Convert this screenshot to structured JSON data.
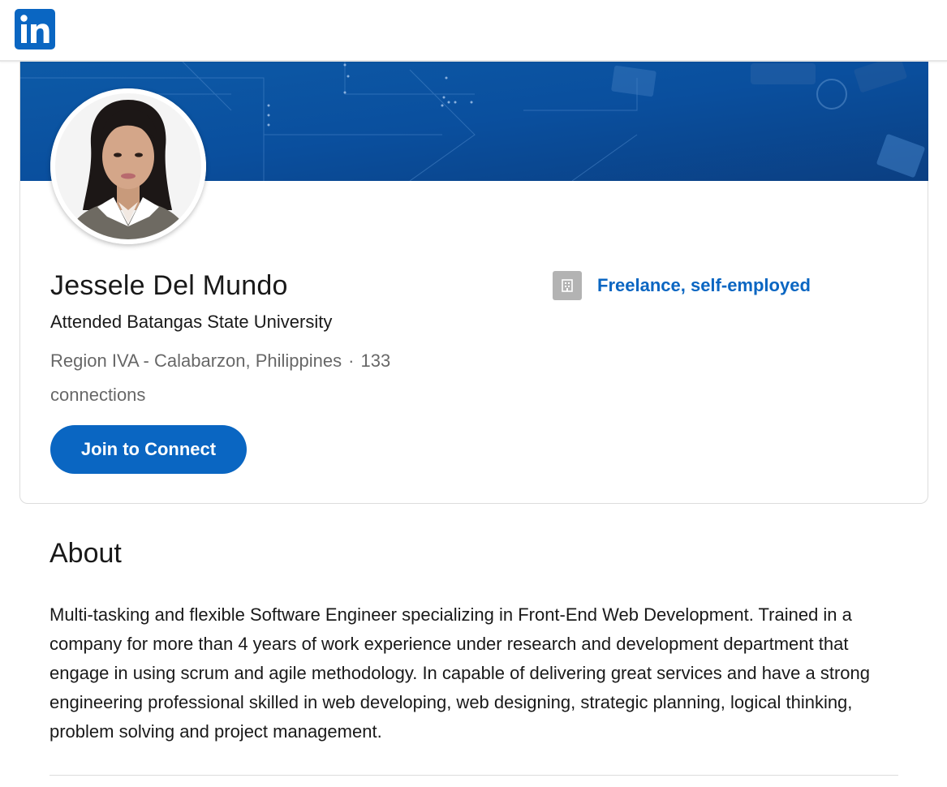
{
  "header": {
    "logo_icon": "linkedin-logo-icon",
    "brand_color": "#0a66c2"
  },
  "profile": {
    "name": "Jessele Del Mundo",
    "headline": "Attended Batangas State University",
    "location": "Region IVA - Calabarzon, Philippines",
    "separator": "·",
    "connections": "133 connections",
    "join_button_label": "Join to Connect",
    "avatar_icon": "profile-photo",
    "cover_icon": "cover-banner-image",
    "current_company": {
      "name": "Freelance, self-employed",
      "icon": "company-building-icon"
    }
  },
  "about": {
    "title": "About",
    "text": "Multi-tasking and flexible Software Engineer specializing in Front-End Web Development. Trained in a company for more than 4 years of work experience under research and development department that engage in using scrum and agile methodology. In capable of delivering great services and have a strong engineering professional skilled in web developing, web designing, strategic planning, logical thinking, problem solving and project management."
  }
}
